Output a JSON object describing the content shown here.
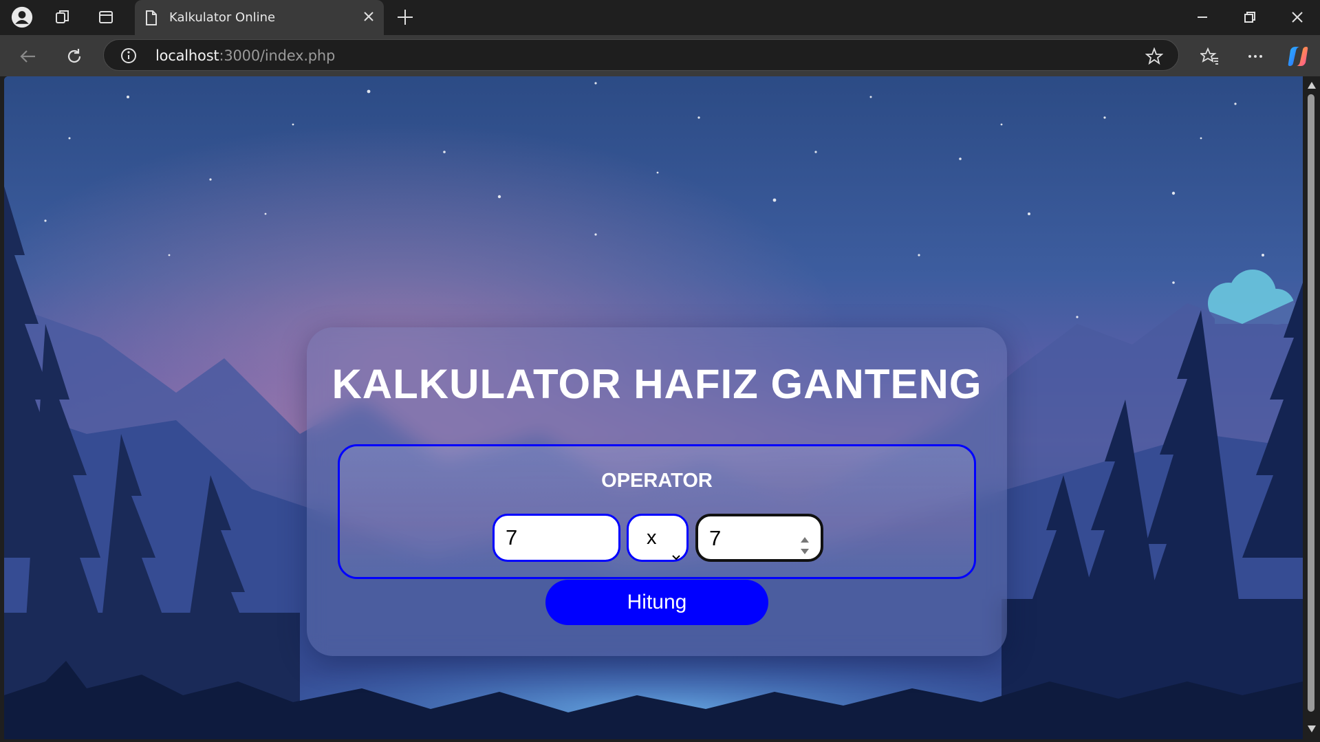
{
  "browser": {
    "tab": {
      "title": "Kalkulator Online"
    },
    "address": {
      "host": "localhost",
      "rest": ":3000/index.php"
    }
  },
  "calculator": {
    "title": "KALKULATOR HAFIZ GANTENG",
    "operator_label": "OPERATOR",
    "first_number": "7",
    "operator": "x",
    "second_number": "7",
    "submit_label": "Hitung"
  },
  "colors": {
    "accent": "#0000ff",
    "input_bg": "#ffffff",
    "title_text": "#ffffff"
  }
}
